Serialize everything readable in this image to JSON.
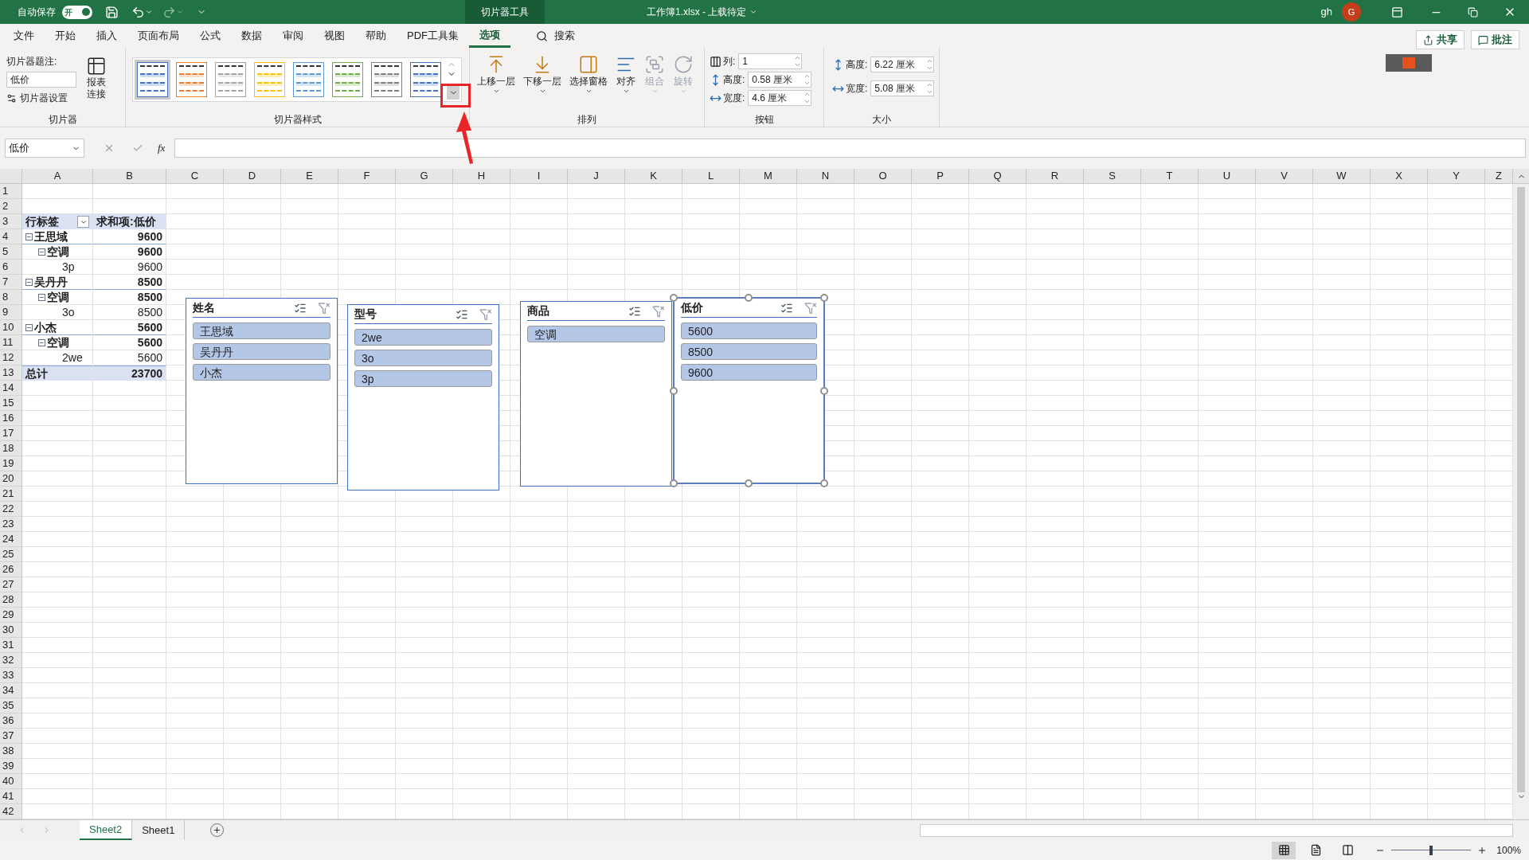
{
  "title_bar": {
    "autosave_label": "自动保存",
    "autosave_toggle": {
      "label": "开",
      "on": true
    },
    "context_tab": "切片器工具",
    "file_title": "工作簿1.xlsx - 上载待定",
    "user": "gh",
    "avatar": "G"
  },
  "menu_tabs": [
    {
      "label": "文件",
      "selected": false
    },
    {
      "label": "开始",
      "selected": false
    },
    {
      "label": "插入",
      "selected": false
    },
    {
      "label": "页面布局",
      "selected": false
    },
    {
      "label": "公式",
      "selected": false
    },
    {
      "label": "数据",
      "selected": false
    },
    {
      "label": "审阅",
      "selected": false
    },
    {
      "label": "视图",
      "selected": false
    },
    {
      "label": "帮助",
      "selected": false
    },
    {
      "label": "PDF工具集",
      "selected": false
    },
    {
      "label": "选项",
      "selected": true
    }
  ],
  "search": "搜索",
  "share": "共享",
  "comments": "批注",
  "ribbon": {
    "slicer_group": {
      "caption_label": "切片器题注:",
      "caption_value": "低价",
      "settings": "切片器设置",
      "report_connections": "报表连接",
      "label": "切片器"
    },
    "styles_group": {
      "label": "切片器样式",
      "styles": [
        {
          "color": "#4472c4",
          "selected": true
        },
        {
          "color": "#ed7d31",
          "selected": false
        },
        {
          "color": "#a5a5a5",
          "selected": false
        },
        {
          "color": "#ffc000",
          "selected": false
        },
        {
          "color": "#5b9bd5",
          "selected": false
        },
        {
          "color": "#70ad47",
          "selected": false
        },
        {
          "color": "#7f7f7f",
          "selected": false
        },
        {
          "color": "#4472c4",
          "selected": false
        }
      ]
    },
    "arrange_group": {
      "label": "排列",
      "buttons": [
        {
          "label": "上移一层",
          "kind": "bring",
          "disabled": false
        },
        {
          "label": "下移一层",
          "kind": "send",
          "disabled": false
        },
        {
          "label": "选择窗格",
          "kind": "pane",
          "disabled": false
        },
        {
          "label": "对齐",
          "kind": "align",
          "disabled": false
        },
        {
          "label": "组合",
          "kind": "group",
          "disabled": true
        },
        {
          "label": "旋转",
          "kind": "rotate",
          "disabled": true
        }
      ]
    },
    "buttons_group": {
      "label": "按钮",
      "fields": [
        {
          "label": "列:",
          "value": "1"
        },
        {
          "label": "高度:",
          "value": "0.58 厘米"
        },
        {
          "label": "宽度:",
          "value": "4.6 厘米"
        }
      ]
    },
    "size_group": {
      "label": "大小",
      "fields": [
        {
          "label": "高度:",
          "value": "6.22 厘米"
        },
        {
          "label": "宽度:",
          "value": "5.08 厘米"
        }
      ]
    }
  },
  "formula_bar": {
    "name_box": "低价",
    "fx": "fx"
  },
  "row_numbers": [
    "1",
    "2",
    "3",
    "4",
    "5",
    "6",
    "7",
    "8",
    "9",
    "10",
    "11",
    "12",
    "13",
    "14",
    "15",
    "16",
    "17",
    "18",
    "19",
    "20",
    "21",
    "22",
    "23",
    "24",
    "25",
    "26",
    "27",
    "28",
    "29",
    "30",
    "31",
    "32",
    "33",
    "34",
    "35",
    "36",
    "37",
    "38",
    "39",
    "40",
    "41",
    "42"
  ],
  "columns": [
    "A",
    "B",
    "C",
    "D",
    "E",
    "F",
    "G",
    "H",
    "I",
    "J",
    "K",
    "L",
    "M",
    "N",
    "O",
    "P",
    "Q",
    "R",
    "S",
    "T",
    "U",
    "V",
    "W",
    "X",
    "Y",
    "Z"
  ],
  "pivot": {
    "header": [
      "行标签",
      "求和项:低价"
    ],
    "rows": [
      {
        "label": "王思域",
        "value": "9600",
        "expanded": true,
        "children": [
          {
            "label": "空调",
            "value": "9600",
            "expanded": true,
            "children": [
              {
                "label": "3p",
                "value": "9600"
              }
            ]
          }
        ]
      },
      {
        "label": "吴丹丹",
        "value": "8500",
        "expanded": true,
        "children": [
          {
            "label": "空调",
            "value": "8500",
            "expanded": true,
            "children": [
              {
                "label": "3o",
                "value": "8500"
              }
            ]
          }
        ]
      },
      {
        "label": "小杰",
        "value": "5600",
        "expanded": true,
        "children": [
          {
            "label": "空调",
            "value": "5600",
            "expanded": true,
            "children": [
              {
                "label": "2we",
                "value": "5600"
              }
            ]
          }
        ]
      }
    ],
    "total": {
      "label": "总计",
      "value": "23700"
    }
  },
  "slicers": [
    {
      "title": "姓名",
      "selected": false,
      "items": [
        {
          "label": "王思域",
          "selected": true
        },
        {
          "label": "吴丹丹",
          "selected": true
        },
        {
          "label": "小杰",
          "selected": true
        }
      ]
    },
    {
      "title": "型号",
      "selected": false,
      "items": [
        {
          "label": "2we",
          "selected": true
        },
        {
          "label": "3o",
          "selected": true
        },
        {
          "label": "3p",
          "selected": true
        }
      ]
    },
    {
      "title": "商品",
      "selected": false,
      "items": [
        {
          "label": "空调",
          "selected": true
        }
      ]
    },
    {
      "title": "低价",
      "selected": true,
      "items": [
        {
          "label": "5600",
          "selected": true
        },
        {
          "label": "8500",
          "selected": true
        },
        {
          "label": "9600",
          "selected": true
        }
      ]
    }
  ],
  "sheet_tabs": [
    {
      "label": "Sheet2",
      "selected": true
    },
    {
      "label": "Sheet1",
      "selected": false
    }
  ],
  "status_bar": {
    "views": [
      {
        "kind": "normal",
        "selected": true
      },
      {
        "kind": "layout",
        "selected": false
      },
      {
        "kind": "break",
        "selected": false
      }
    ],
    "zoom": {
      "level": 0.5,
      "reading": "100%"
    }
  }
}
